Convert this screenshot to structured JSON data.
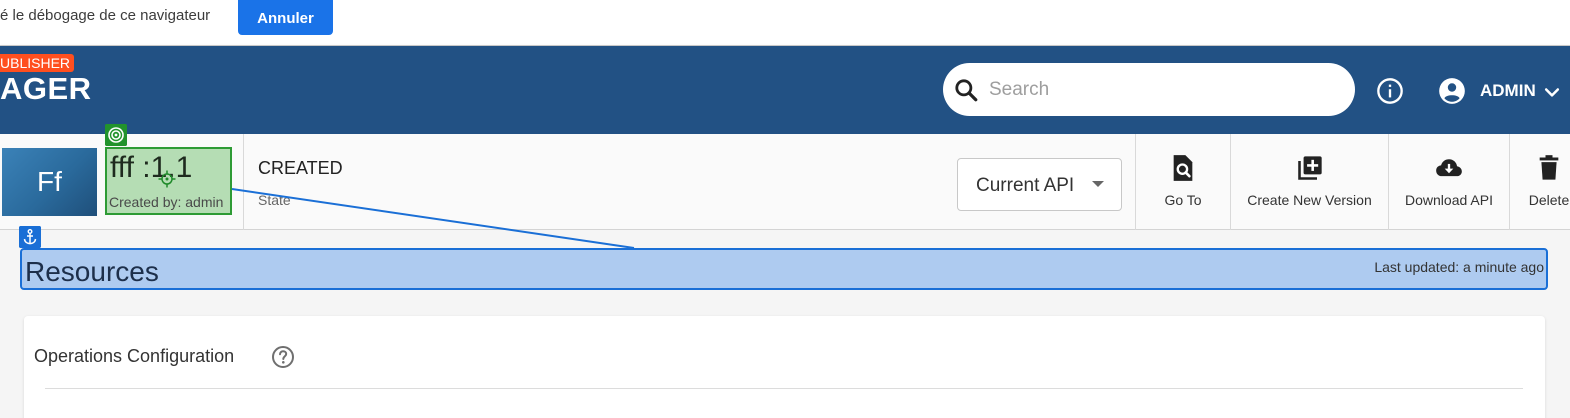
{
  "debug_banner": {
    "message": "é le débogage de ce navigateur",
    "cancel_label": "Annuler"
  },
  "header": {
    "brand_badge": "UBLISHER",
    "brand_title": "AGER",
    "search_placeholder": "Search",
    "user_name": "ADMIN"
  },
  "api": {
    "thumbnail_text": "Ff",
    "name": "fff :1.1",
    "created_by": "Created by: admin",
    "state_value": "CREATED",
    "state_label": "State",
    "version_selected": "Current API"
  },
  "actions": [
    {
      "label": "Go To",
      "icon": "search-document-icon"
    },
    {
      "label": "Create New Version",
      "icon": "add-library-icon"
    },
    {
      "label": "Download API",
      "icon": "cloud-download-icon"
    },
    {
      "label": "Delete",
      "icon": "trash-icon"
    }
  ],
  "resources": {
    "title": "Resources",
    "last_updated": "Last updated: a minute ago"
  },
  "operations": {
    "title": "Operations Configuration"
  },
  "colors": {
    "header_bg": "#225184",
    "brand_badge": "#ff4f1f",
    "primary_button": "#1a73e8",
    "highlight_green": "#2e9b35",
    "highlight_blue": "#1a6fd6"
  }
}
